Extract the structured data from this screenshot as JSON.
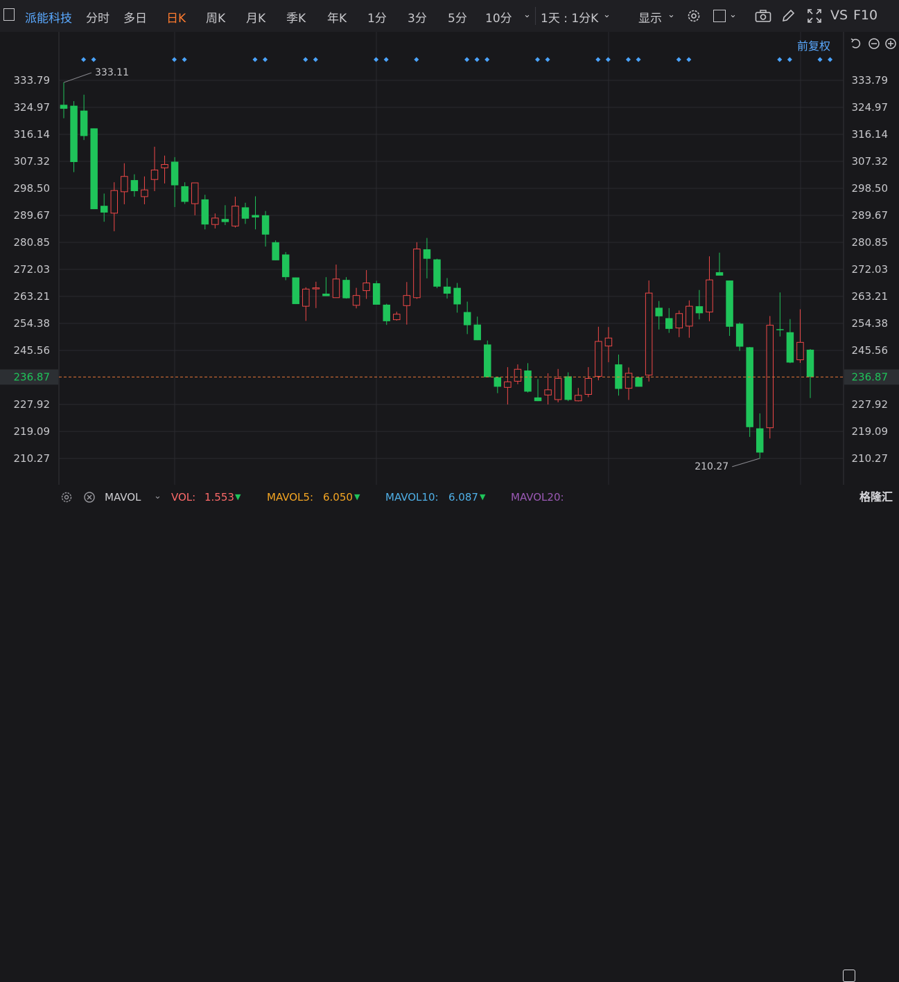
{
  "toolbar": {
    "stock_name": "派能科技",
    "tabs": [
      "分时",
      "多日",
      "日K",
      "周K",
      "月K",
      "季K",
      "年K",
      "1分",
      "3分",
      "5分",
      "10分"
    ],
    "active_tab": "日K",
    "period_select": "1天 : 1分K",
    "display_label": "显示",
    "vs_label": "VS",
    "f10_label": "F10"
  },
  "adjust_label": "前复权",
  "footer": {
    "indicator": "MAVOL",
    "vol_label": "VOL:",
    "vol_value": "1.553",
    "ma5_label": "MAVOL5:",
    "ma5_value": "6.050",
    "ma10_label": "MAVOL10:",
    "ma10_value": "6.087",
    "ma20_label": "MAVOL20:",
    "watermark": "格隆汇"
  },
  "colors": {
    "up": "#f04848",
    "down": "#1fc45a",
    "marker": "#4aa3ff",
    "tab_active": "#ff7b2e",
    "vol": "#ff6a6a",
    "ma5": "#f5a623",
    "ma10": "#4fb0e8",
    "ma20": "#9b59b6",
    "last_price": "#e8763a"
  },
  "chart_data": {
    "type": "candlestick",
    "y_ticks": [
      "333.79",
      "324.97",
      "316.14",
      "307.32",
      "298.50",
      "289.67",
      "280.85",
      "272.03",
      "263.21",
      "254.38",
      "245.56",
      "236.87",
      "227.92",
      "219.09",
      "210.27"
    ],
    "y_range": [
      210.27,
      333.79
    ],
    "last_price": "236.87",
    "max_label": "333.11",
    "min_label": "210.27",
    "grid": true,
    "candles": [
      {
        "o": 325.8,
        "h": 333.1,
        "l": 321.4,
        "c": 324.5
      },
      {
        "o": 325.5,
        "h": 327.0,
        "l": 303.8,
        "c": 307.1
      },
      {
        "o": 323.9,
        "h": 329.1,
        "l": 314.3,
        "c": 315.6
      },
      {
        "o": 318.1,
        "h": 318.1,
        "l": 291.7,
        "c": 291.7
      },
      {
        "o": 292.8,
        "h": 296.8,
        "l": 287.6,
        "c": 290.6
      },
      {
        "o": 290.4,
        "h": 300.5,
        "l": 284.5,
        "c": 297.8
      },
      {
        "o": 297.4,
        "h": 306.7,
        "l": 293.3,
        "c": 302.4
      },
      {
        "o": 301.2,
        "h": 303.1,
        "l": 295.8,
        "c": 297.6
      },
      {
        "o": 295.8,
        "h": 302.4,
        "l": 293.3,
        "c": 298.0
      },
      {
        "o": 301.4,
        "h": 312.1,
        "l": 297.6,
        "c": 304.5
      },
      {
        "o": 305.2,
        "h": 309.2,
        "l": 300.1,
        "c": 306.3
      },
      {
        "o": 307.2,
        "h": 308.7,
        "l": 292.4,
        "c": 299.5
      },
      {
        "o": 299.2,
        "h": 300.5,
        "l": 293.4,
        "c": 294.1
      },
      {
        "o": 293.5,
        "h": 300.3,
        "l": 289.7,
        "c": 300.3
      },
      {
        "o": 294.9,
        "h": 296.4,
        "l": 285.1,
        "c": 286.7
      },
      {
        "o": 286.7,
        "h": 290.3,
        "l": 285.4,
        "c": 288.8
      },
      {
        "o": 288.5,
        "h": 293.0,
        "l": 286.5,
        "c": 287.5
      },
      {
        "o": 286.2,
        "h": 295.8,
        "l": 285.7,
        "c": 292.7
      },
      {
        "o": 292.3,
        "h": 293.8,
        "l": 286.9,
        "c": 288.6
      },
      {
        "o": 289.8,
        "h": 295.9,
        "l": 285.1,
        "c": 289.0
      },
      {
        "o": 289.7,
        "h": 291.1,
        "l": 279.5,
        "c": 283.4
      },
      {
        "o": 280.9,
        "h": 281.5,
        "l": 275.0,
        "c": 275.0
      },
      {
        "o": 276.9,
        "h": 277.7,
        "l": 268.5,
        "c": 269.5
      },
      {
        "o": 269.4,
        "h": 269.4,
        "l": 260.7,
        "c": 260.7
      },
      {
        "o": 260.0,
        "h": 266.2,
        "l": 255.2,
        "c": 265.6
      },
      {
        "o": 265.7,
        "h": 268.0,
        "l": 259.4,
        "c": 266.0
      },
      {
        "o": 264.1,
        "h": 269.5,
        "l": 263.4,
        "c": 263.3
      },
      {
        "o": 262.8,
        "h": 273.6,
        "l": 262.8,
        "c": 268.9
      },
      {
        "o": 268.6,
        "h": 269.5,
        "l": 262.5,
        "c": 262.6
      },
      {
        "o": 260.3,
        "h": 266.0,
        "l": 259.3,
        "c": 263.5
      },
      {
        "o": 265.1,
        "h": 271.8,
        "l": 262.4,
        "c": 267.6
      },
      {
        "o": 267.5,
        "h": 268.3,
        "l": 260.5,
        "c": 260.5
      },
      {
        "o": 260.5,
        "h": 260.8,
        "l": 253.9,
        "c": 255.1
      },
      {
        "o": 255.6,
        "h": 258.2,
        "l": 255.3,
        "c": 257.4
      },
      {
        "o": 260.2,
        "h": 267.9,
        "l": 254.0,
        "c": 263.5
      },
      {
        "o": 262.8,
        "h": 280.9,
        "l": 262.4,
        "c": 278.7
      },
      {
        "o": 278.6,
        "h": 282.3,
        "l": 269.1,
        "c": 275.5
      },
      {
        "o": 275.3,
        "h": 275.5,
        "l": 265.9,
        "c": 266.4
      },
      {
        "o": 266.4,
        "h": 269.2,
        "l": 262.5,
        "c": 264.1
      },
      {
        "o": 266.0,
        "h": 267.6,
        "l": 257.9,
        "c": 260.6
      },
      {
        "o": 258.1,
        "h": 261.5,
        "l": 250.9,
        "c": 253.8
      },
      {
        "o": 254.0,
        "h": 256.6,
        "l": 248.9,
        "c": 248.9
      },
      {
        "o": 247.5,
        "h": 248.8,
        "l": 236.8,
        "c": 236.8
      },
      {
        "o": 236.8,
        "h": 236.8,
        "l": 231.6,
        "c": 233.7
      },
      {
        "o": 233.5,
        "h": 240.1,
        "l": 227.9,
        "c": 235.3
      },
      {
        "o": 235.5,
        "h": 241.0,
        "l": 234.5,
        "c": 239.4
      },
      {
        "o": 239.0,
        "h": 241.4,
        "l": 231.8,
        "c": 232.1
      },
      {
        "o": 230.2,
        "h": 236.2,
        "l": 230.0,
        "c": 229.0
      },
      {
        "o": 231.0,
        "h": 238.1,
        "l": 227.9,
        "c": 232.7
      },
      {
        "o": 229.5,
        "h": 239.5,
        "l": 228.6,
        "c": 236.4
      },
      {
        "o": 237.1,
        "h": 238.4,
        "l": 229.0,
        "c": 229.4
      },
      {
        "o": 229.1,
        "h": 233.3,
        "l": 228.9,
        "c": 230.9
      },
      {
        "o": 231.2,
        "h": 240.1,
        "l": 230.3,
        "c": 236.4
      },
      {
        "o": 237.1,
        "h": 253.3,
        "l": 235.8,
        "c": 248.5
      },
      {
        "o": 247.0,
        "h": 253.2,
        "l": 241.7,
        "c": 249.6
      },
      {
        "o": 241.0,
        "h": 244.2,
        "l": 230.8,
        "c": 233.0
      },
      {
        "o": 233.2,
        "h": 240.0,
        "l": 229.4,
        "c": 238.1
      },
      {
        "o": 236.8,
        "h": 235.4,
        "l": 236.2,
        "c": 233.7
      },
      {
        "o": 237.5,
        "h": 268.4,
        "l": 235.4,
        "c": 264.3
      },
      {
        "o": 259.5,
        "h": 261.7,
        "l": 252.4,
        "c": 256.7
      },
      {
        "o": 256.1,
        "h": 259.4,
        "l": 251.3,
        "c": 252.6
      },
      {
        "o": 252.9,
        "h": 258.6,
        "l": 249.9,
        "c": 257.6
      },
      {
        "o": 253.5,
        "h": 261.9,
        "l": 249.7,
        "c": 260.0
      },
      {
        "o": 260.0,
        "h": 265.3,
        "l": 255.7,
        "c": 257.7
      },
      {
        "o": 258.1,
        "h": 276.3,
        "l": 255.1,
        "c": 268.6
      },
      {
        "o": 271.1,
        "h": 277.5,
        "l": 271.1,
        "c": 270.0
      },
      {
        "o": 268.4,
        "h": 268.4,
        "l": 250.3,
        "c": 253.3
      },
      {
        "o": 254.3,
        "h": 254.7,
        "l": 245.4,
        "c": 246.8
      },
      {
        "o": 246.6,
        "h": 246.7,
        "l": 217.3,
        "c": 220.5
      },
      {
        "o": 220.1,
        "h": 225.0,
        "l": 210.3,
        "c": 212.2
      },
      {
        "o": 220.3,
        "h": 256.8,
        "l": 216.8,
        "c": 253.8
      },
      {
        "o": 252.5,
        "h": 264.5,
        "l": 250.1,
        "c": 252.4
      },
      {
        "o": 251.5,
        "h": 255.8,
        "l": 241.4,
        "c": 241.6
      },
      {
        "o": 242.5,
        "h": 259.0,
        "l": 241.5,
        "c": 248.2
      },
      {
        "o": 245.8,
        "h": 246.0,
        "l": 230.0,
        "c": 236.9
      }
    ],
    "markers": [
      [
        {
          "i": 1
        },
        {
          "i": 2
        }
      ],
      [
        {
          "i": 10
        },
        {
          "i": 11
        }
      ],
      [
        {
          "i": 18
        },
        {
          "i": 19
        }
      ],
      [
        {
          "i": 23
        },
        {
          "i": 24
        }
      ],
      [
        {
          "i": 30
        },
        {
          "i": 31
        }
      ],
      [
        {
          "i": 34
        }
      ],
      [
        {
          "i": 39
        },
        {
          "i": 40
        },
        {
          "i": 41
        }
      ],
      [
        {
          "i": 46
        },
        {
          "i": 47
        }
      ],
      [
        {
          "i": 52
        },
        {
          "i": 53
        }
      ],
      [
        {
          "i": 55
        },
        {
          "i": 56
        }
      ],
      [
        {
          "i": 60
        },
        {
          "i": 61
        }
      ],
      [
        {
          "i": 70
        },
        {
          "i": 71
        }
      ],
      [
        {
          "i": 74
        },
        {
          "i": 75
        }
      ]
    ]
  }
}
